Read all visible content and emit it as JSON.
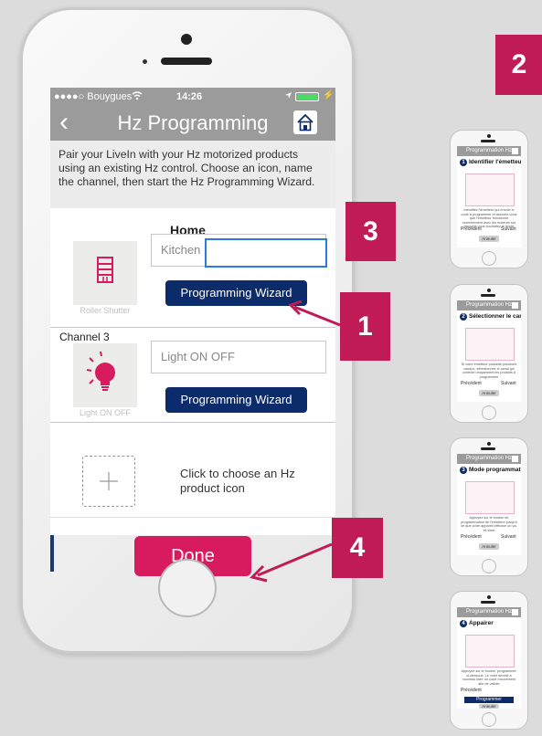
{
  "status": {
    "carrier": "●●●●○ Bouygues",
    "time": "14:26"
  },
  "nav": {
    "title": "Hz Programming"
  },
  "intro": "Pair your LiveIn with your Hz motorized products using an existing Hz control. Choose an icon, name the channel, then start the Hz Programming Wizard.",
  "home_section": {
    "title": "Home",
    "channel1": {
      "tile_caption": "Roller Shutter",
      "field_value": "Kitchen",
      "button": "Programming Wizard"
    },
    "channel3": {
      "label": "Channel 3",
      "tile_caption": "Light ON OFF",
      "field_value": "Light ON OFF",
      "button": "Programming Wizard"
    },
    "add_product": {
      "text": "Click to choose an Hz product icon"
    }
  },
  "done_label": "Done",
  "badges": {
    "b1": "1",
    "b2": "2",
    "b3": "3",
    "b4": "4"
  },
  "colors": {
    "accent": "#d81b5f",
    "navy": "#0c2b6a",
    "badge": "#c01b55",
    "navbar": "#9b9b9b"
  },
  "mini_phones": [
    {
      "title": "Programmation Hz",
      "step": "1",
      "heading": "Identifier l'émetteur",
      "text": "Identifiez l'émetteur qui envoie le code à programmer et assurez-vous que l'émetteur fonctionne correctement avec les moteurs sur lesquels vous souhaitez le mode",
      "prev": "Précédent",
      "next": "Suivant",
      "button": "Annuler"
    },
    {
      "title": "Programmation Hz",
      "step": "2",
      "heading": "Sélectionner le canal",
      "text": "Si votre émetteur possède plusieurs canaux, sélectionnez le canal qui contrôle uniquement les produits à programmer",
      "prev": "Précédent",
      "next": "Suivant",
      "button": "Annuler"
    },
    {
      "title": "Programmation Hz",
      "step": "3",
      "heading": "Mode programmation",
      "text": "Appuyez sur le bouton de programmation de l'émetteur jusqu'à ce que votre appareil effectue un va-et-vient",
      "prev": "Précédent",
      "next": "Suivant",
      "button": "Annuler"
    },
    {
      "title": "Programmation Hz",
      "step": "4",
      "heading": "Appairer",
      "text": "Appuyez sur le bouton 'programmer' ci-dessous. Le volet devrait à nouveau faire un court mouvement afin de valider",
      "prev": "Précédent",
      "next": "",
      "button": "Programmer",
      "button2": "Annuler"
    }
  ]
}
